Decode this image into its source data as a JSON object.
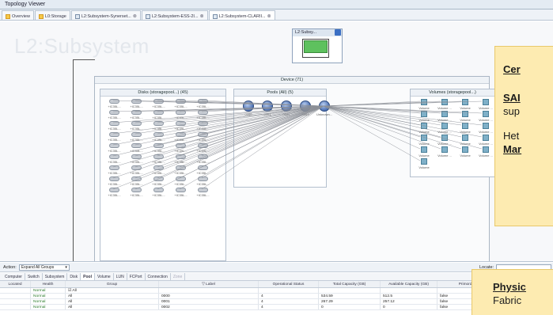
{
  "window": {
    "title": "Topology Viewer"
  },
  "tabs": [
    {
      "label": "Overview",
      "icon": "warning-icon",
      "active": false
    },
    {
      "label": "L0:Storage",
      "icon": "warning-icon",
      "active": false
    },
    {
      "label": "L2:Subsystem-Synerset...",
      "icon": "subsystem-icon",
      "active": false
    },
    {
      "label": "L2:Subsystem-ESS-2I...",
      "icon": "subsystem-icon",
      "active": false
    },
    {
      "label": "L2:Subsystem-CLARII...",
      "icon": "subsystem-icon",
      "active": true
    }
  ],
  "canvas": {
    "watermark": "L2:Subsystem",
    "minimap_title": "L2:Subsy...",
    "device": {
      "title": "Device (71)",
      "disks": {
        "title": "Disks (storagepool...) (45)",
        "label": "+IC35L...",
        "count": 45
      },
      "pools": {
        "title": "Pools (All) (5)",
        "items": [
          "0000",
          "0001",
          "0002",
          "0003",
          "Unknown..."
        ]
      },
      "volumes": {
        "title": "Volumes (storagepool...)",
        "label_full": "Volume",
        "label_short": "Volume ...",
        "count": 21
      }
    }
  },
  "callout_right": {
    "line1": "Cer",
    "line2": "SAI",
    "line3": "sup",
    "line4": "Het",
    "line5": "Mar"
  },
  "actionbar": {
    "action_label": "Action:",
    "action_value": "Expand All Groups",
    "locate_label": "Locate:"
  },
  "subtabs": [
    {
      "label": "Computer",
      "state": "normal"
    },
    {
      "label": "Switch",
      "state": "normal"
    },
    {
      "label": "Subsystem",
      "state": "normal"
    },
    {
      "label": "Disk",
      "state": "normal"
    },
    {
      "label": "Pool",
      "state": "active"
    },
    {
      "label": "Volume",
      "state": "normal"
    },
    {
      "label": "LUN",
      "state": "normal"
    },
    {
      "label": "FCPort",
      "state": "normal"
    },
    {
      "label": "Connection",
      "state": "normal"
    },
    {
      "label": "Zone",
      "state": "disabled"
    }
  ],
  "table": {
    "columns": [
      "Located",
      "Health",
      "Group",
      "▽ Label",
      "Operational Status",
      "Total Capacity (GB)",
      "Available Capacity (GB)",
      "Primordial",
      "RAID Level"
    ],
    "rows": [
      {
        "located": "",
        "health": "Normal",
        "group": "☑ All",
        "label": "",
        "op": "",
        "total": "",
        "avail": "",
        "prim": "",
        "raid": ""
      },
      {
        "located": "",
        "health": "Normal",
        "group": "All",
        "label": "0000",
        "op": "4",
        "total": "534.59",
        "avail": "512.5",
        "prim": "false",
        "raid": "n/a"
      },
      {
        "located": "",
        "health": "Normal",
        "group": "All",
        "label": "0001",
        "op": "4",
        "total": "267.29",
        "avail": "257.12",
        "prim": "false",
        "raid": "n/a"
      },
      {
        "located": "",
        "health": "Normal",
        "group": "All",
        "label": "0002",
        "op": "4",
        "total": "0",
        "avail": "0",
        "prim": "false",
        "raid": "n/a"
      }
    ]
  },
  "callout_bottom": {
    "line1": "Physic",
    "line2": "Fabric"
  },
  "colors": {
    "callout_bg": "#fdebb1",
    "pool": "#4b6fb1",
    "health_ok": "#2a7a2a"
  }
}
